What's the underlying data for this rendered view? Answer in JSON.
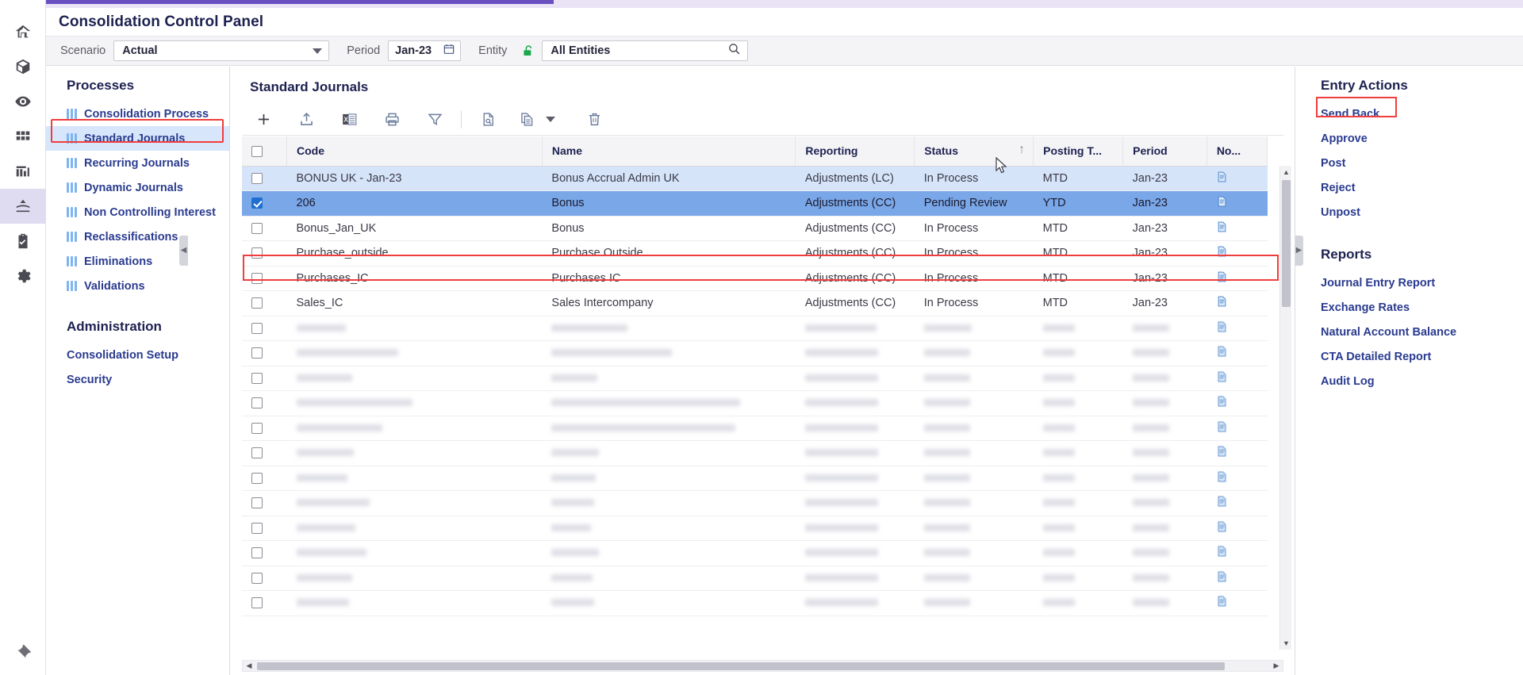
{
  "app": {
    "page_title": "Consolidation Control Panel"
  },
  "rail": {
    "items": [
      {
        "icon": "home-icon"
      },
      {
        "icon": "cube-icon"
      },
      {
        "icon": "eye-icon"
      },
      {
        "icon": "grid-icon"
      },
      {
        "icon": "bar-chart-icon"
      },
      {
        "icon": "consolidation-icon"
      },
      {
        "icon": "clipboard-check-icon"
      },
      {
        "icon": "gear-icon"
      }
    ],
    "bottom_icon": "pin-icon",
    "active_index": 5
  },
  "filters": {
    "scenario_label": "Scenario",
    "scenario_value": "Actual",
    "period_label": "Period",
    "period_value": "Jan-23",
    "period_icon": "calendar-icon",
    "entity_label": "Entity",
    "entity_lock_icon": "unlock-icon",
    "entity_lock_color": "#1ba94c",
    "entity_value": "All Entities",
    "entity_search_icon": "search-icon"
  },
  "sidebar": {
    "processes_title": "Processes",
    "processes": [
      {
        "label": "Consolidation Process",
        "selected": false
      },
      {
        "label": "Standard Journals",
        "selected": true
      },
      {
        "label": "Recurring Journals",
        "selected": false
      },
      {
        "label": "Dynamic Journals",
        "selected": false
      },
      {
        "label": "Non Controlling Interest",
        "selected": false
      },
      {
        "label": "Reclassifications",
        "selected": false
      },
      {
        "label": "Eliminations",
        "selected": false
      },
      {
        "label": "Validations",
        "selected": false
      }
    ],
    "administration_title": "Administration",
    "administration": [
      {
        "label": "Consolidation Setup"
      },
      {
        "label": "Security"
      }
    ]
  },
  "main": {
    "title": "Standard Journals",
    "toolbar": [
      {
        "name": "add-button",
        "icon": "plus-icon"
      },
      {
        "name": "import-button",
        "icon": "upload-icon"
      },
      {
        "name": "export-excel-button",
        "icon": "excel-icon"
      },
      {
        "name": "print-button",
        "icon": "print-icon"
      },
      {
        "name": "filter-button",
        "icon": "funnel-icon"
      },
      {
        "name": "view-details-button",
        "icon": "document-search-icon"
      },
      {
        "name": "copy-button",
        "icon": "copy-icon"
      },
      {
        "name": "delete-button",
        "icon": "trash-icon"
      }
    ],
    "columns": [
      "Code",
      "Name",
      "Reporting",
      "Status",
      "Posting T...",
      "Period",
      "No..."
    ],
    "sort_column": "Status",
    "sort_direction": "asc",
    "rows": [
      {
        "code": "BONUS UK - Jan-23",
        "name": "Bonus Accrual Admin UK",
        "reporting": "Adjustments (LC)",
        "status": "In Process",
        "posting_type": "MTD",
        "period": "Jan-23",
        "checked": false,
        "state": "hover"
      },
      {
        "code": "206",
        "name": "Bonus",
        "reporting": "Adjustments (CC)",
        "status": "Pending Review",
        "posting_type": "YTD",
        "period": "Jan-23",
        "checked": true,
        "state": "selected"
      },
      {
        "code": "Bonus_Jan_UK",
        "name": "Bonus",
        "reporting": "Adjustments (CC)",
        "status": "In Process",
        "posting_type": "MTD",
        "period": "Jan-23",
        "checked": false,
        "state": "normal"
      },
      {
        "code": "Purchase_outside",
        "name": "Purchase Outside",
        "reporting": "Adjustments (CC)",
        "status": "In Process",
        "posting_type": "MTD",
        "period": "Jan-23",
        "checked": false,
        "state": "normal"
      },
      {
        "code": "Purchases_IC",
        "name": "Purchases IC",
        "reporting": "Adjustments (CC)",
        "status": "In Process",
        "posting_type": "MTD",
        "period": "Jan-23",
        "checked": false,
        "state": "normal"
      },
      {
        "code": "Sales_IC",
        "name": "Sales Intercompany",
        "reporting": "Adjustments (CC)",
        "status": "In Process",
        "posting_type": "MTD",
        "period": "Jan-23",
        "checked": false,
        "state": "normal"
      }
    ],
    "obscured_row_count": 12
  },
  "right": {
    "entry_actions_title": "Entry Actions",
    "entry_actions": [
      {
        "label": "Send Back",
        "highlighted": true
      },
      {
        "label": "Approve",
        "highlighted": false
      },
      {
        "label": "Post",
        "highlighted": false
      },
      {
        "label": "Reject",
        "highlighted": false
      },
      {
        "label": "Unpost",
        "highlighted": false
      }
    ],
    "reports_title": "Reports",
    "reports": [
      {
        "label": "Journal Entry Report"
      },
      {
        "label": "Exchange Rates"
      },
      {
        "label": "Natural Account Balance"
      },
      {
        "label": "CTA Detailed Report"
      },
      {
        "label": "Audit Log"
      }
    ]
  },
  "annotations": {
    "highlight_color": "#f03d3d"
  }
}
